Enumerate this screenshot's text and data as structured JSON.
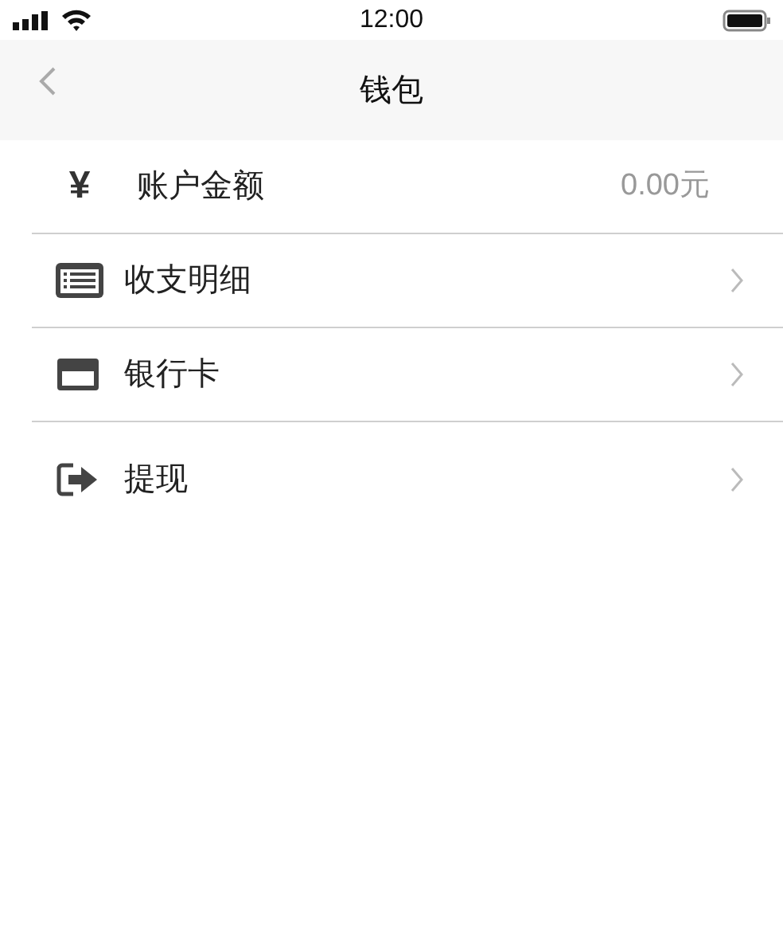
{
  "status_bar": {
    "time": "12:00"
  },
  "nav_bar": {
    "title": "钱包"
  },
  "items": [
    {
      "kind": "balance",
      "symbol": "¥",
      "label": "账户金额",
      "value": "0.00元"
    },
    {
      "kind": "details",
      "label": "收支明细"
    },
    {
      "kind": "card",
      "label": "银行卡"
    },
    {
      "kind": "withdraw",
      "label": "提现"
    }
  ]
}
